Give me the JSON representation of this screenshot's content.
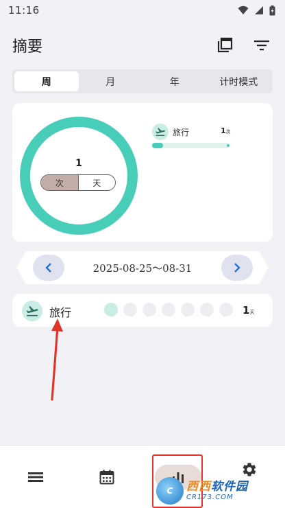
{
  "status": {
    "time": "11:16"
  },
  "header": {
    "title": "摘要"
  },
  "tabs": [
    {
      "label": "周",
      "active": true
    },
    {
      "label": "月",
      "active": false
    },
    {
      "label": "年",
      "active": false
    },
    {
      "label": "计时模式",
      "active": false
    }
  ],
  "summary": {
    "total": "1",
    "unit_options": [
      "次",
      "天"
    ],
    "selected_unit": "次",
    "ring_color": "#47cdb8",
    "legend": [
      {
        "label": "旅行",
        "count": "1",
        "unit": "次",
        "icon": "airplane-departure-icon",
        "bar_fraction": 0.14
      }
    ]
  },
  "date_nav": {
    "range": "2025-08-25～08-31"
  },
  "activities": [
    {
      "label": "旅行",
      "icon": "airplane-departure-icon",
      "days": [
        true,
        false,
        false,
        false,
        false,
        false,
        false
      ],
      "count": "1",
      "unit": "天"
    }
  ],
  "bottom_nav": [
    {
      "icon": "list-icon"
    },
    {
      "icon": "calendar-icon"
    },
    {
      "icon": "bar-chart-icon",
      "active": true
    },
    {
      "icon": "gear-icon"
    }
  ],
  "watermark": {
    "brand_a": "西西",
    "brand_b": "软件园",
    "site": "CR173.COM",
    "logo_text": "C"
  },
  "colors": {
    "accent": "#47cdb8",
    "accent_light": "#c9ece4",
    "annotation": "#e0362a",
    "selected_unit_bg": "#c2aea6"
  }
}
